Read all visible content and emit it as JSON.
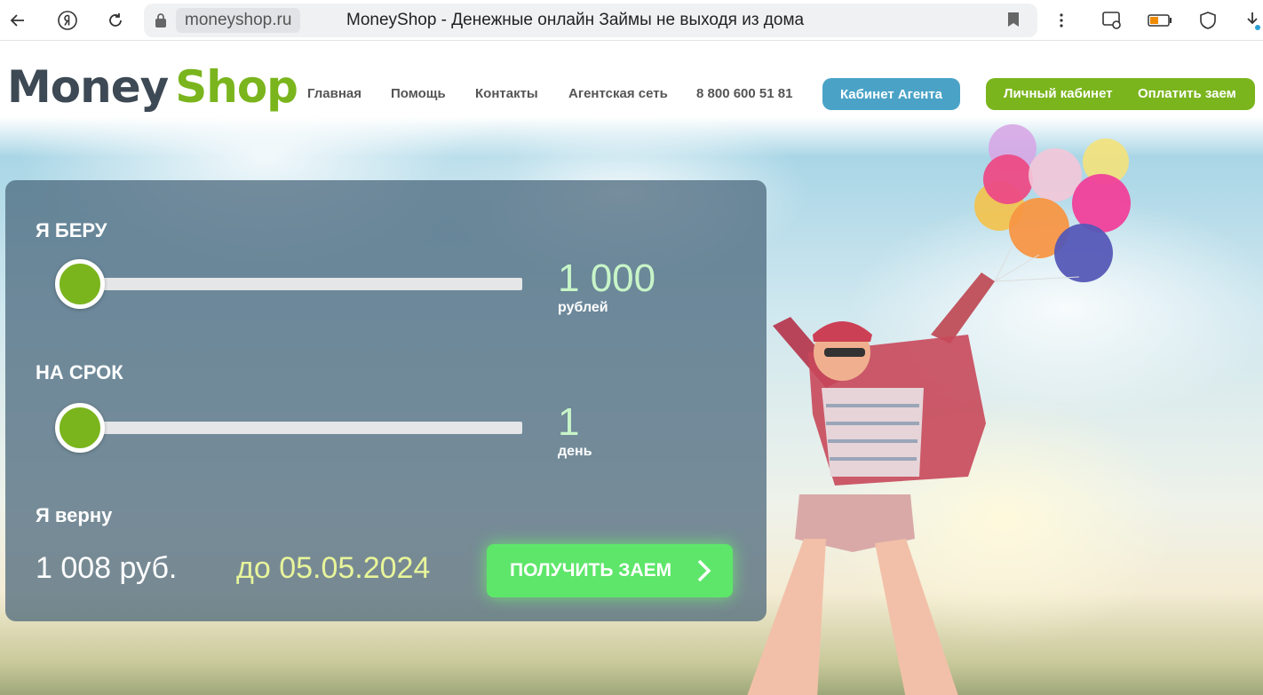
{
  "browser": {
    "domain": "moneyshop.ru",
    "tab_title": "MoneyShop - Денежные онлайн Займы не выходя из дома",
    "icons": [
      "back-icon",
      "yandex-icon",
      "reload-icon",
      "lock-icon",
      "bookmark-icon",
      "menu-dots-icon",
      "screenshot-icon",
      "battery-icon",
      "shield-icon",
      "download-icon"
    ]
  },
  "header": {
    "logo_part1": "Money",
    "logo_part2": "Shop",
    "nav": [
      "Главная",
      "Помощь",
      "Контакты",
      "Агентская сеть"
    ],
    "phone": "8 800 600 51 81",
    "agent_button": "Кабинет Агента",
    "account_button": "Личный кабинет",
    "pay_button": "Оплатить заем"
  },
  "calculator": {
    "amount_label": "Я БЕРУ",
    "amount_value": "1 000",
    "amount_unit": "рублей",
    "amount_slider_fraction": 0,
    "term_label": "НА СРОК",
    "term_value": "1",
    "term_unit": "день",
    "term_slider_fraction": 0,
    "repay_label": "Я верну",
    "repay_amount": "1 008 руб.",
    "repay_date": "до 05.05.2024",
    "get_loan_button": "ПОЛУЧИТЬ ЗАЕМ"
  },
  "colors": {
    "brand_green": "#7ab51d",
    "brand_dark": "#3d4954",
    "agent_blue": "#4aa3c7",
    "cta_green": "#5ee66a"
  }
}
